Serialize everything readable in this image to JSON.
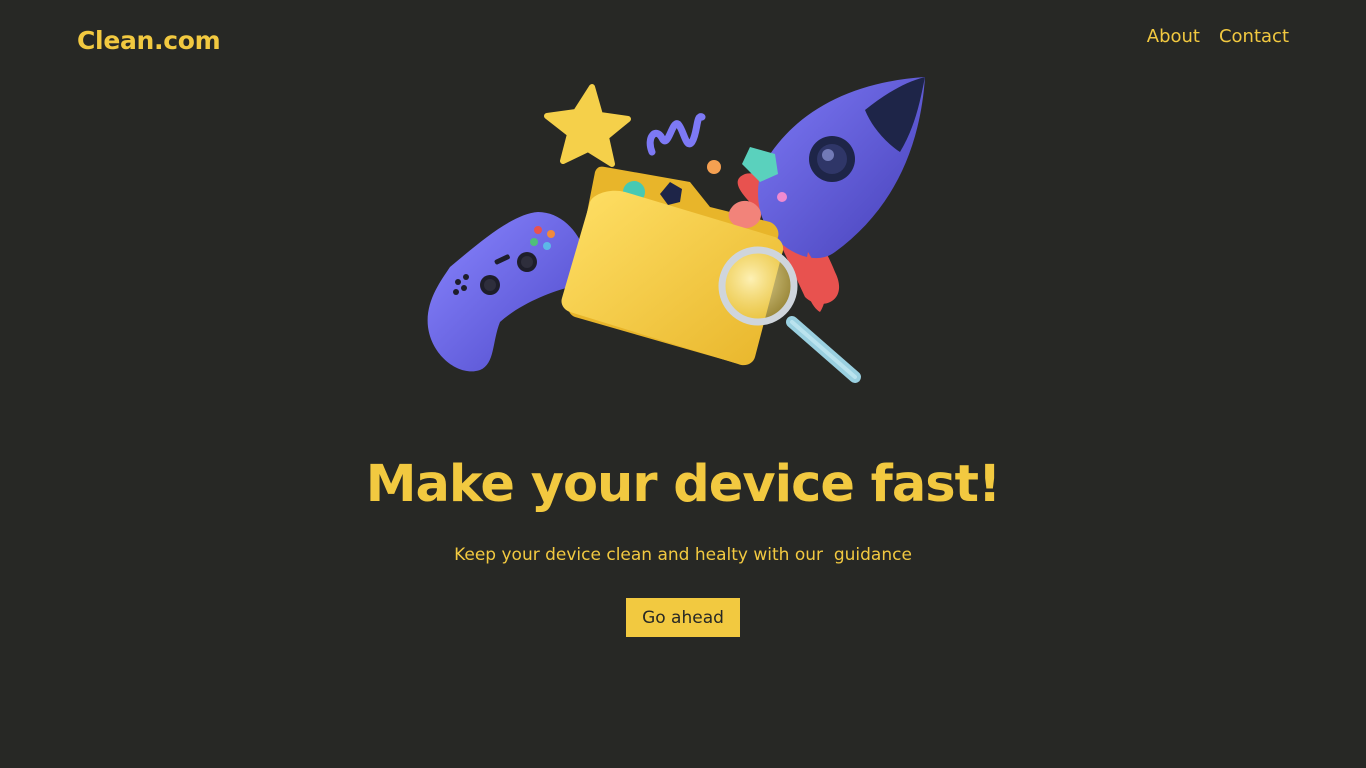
{
  "header": {
    "logo_text": "Clean.com",
    "nav": [
      {
        "label": "About"
      },
      {
        "label": "Contact"
      }
    ]
  },
  "hero": {
    "illustration_items": [
      "gamepad-icon",
      "folder-icon",
      "magnifier-icon",
      "rocket-icon",
      "star-icon"
    ],
    "title": "Make your device fast!",
    "subtitle": "Keep your device clean and healty with our  guidance",
    "cta_label": "Go ahead"
  },
  "colors": {
    "background": "#272825",
    "accent": "#f2c940",
    "illustration_purple": "#6a66e8",
    "illustration_red": "#e8524f",
    "illustration_navy": "#1e2548"
  }
}
